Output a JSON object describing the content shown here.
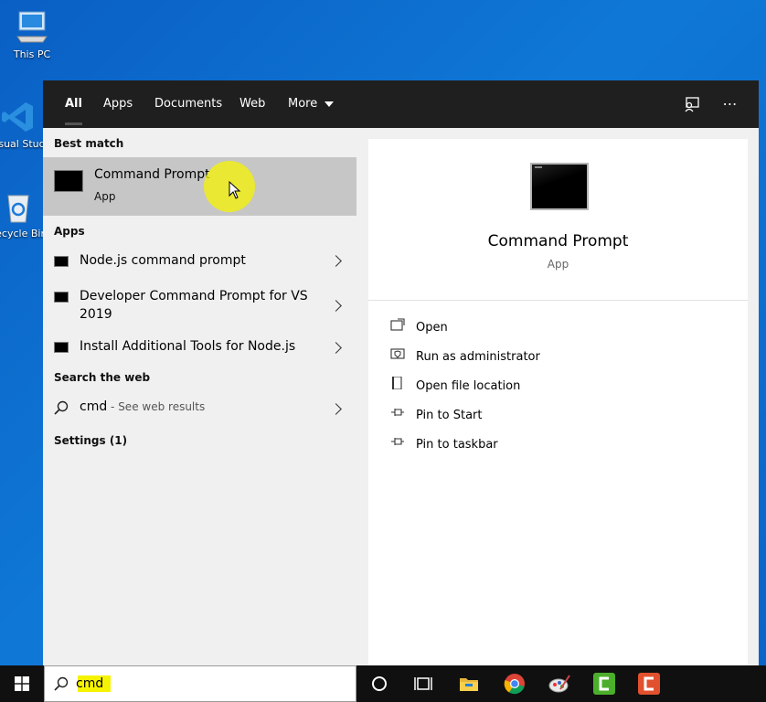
{
  "desktop": {
    "icons": [
      {
        "label": "This PC"
      },
      {
        "label": "Visual Studio Code"
      },
      {
        "label": "Recycle Bin"
      }
    ]
  },
  "search": {
    "tabs": [
      "All",
      "Apps",
      "Documents",
      "Web",
      "More"
    ],
    "best_match_heading": "Best match",
    "best_match": {
      "title": "Command Prompt",
      "subtitle": "App"
    },
    "apps_heading": "Apps",
    "apps": [
      {
        "label": "Node.js command prompt"
      },
      {
        "label": "Developer Command Prompt for VS 2019"
      },
      {
        "label": "Install Additional Tools for Node.js"
      }
    ],
    "web_heading": "Search the web",
    "web_query": "cmd",
    "web_hint": " - See web results",
    "settings_heading": "Settings (1)"
  },
  "preview": {
    "title": "Command Prompt",
    "subtitle": "App",
    "actions": [
      "Open",
      "Run as administrator",
      "Open file location",
      "Pin to Start",
      "Pin to taskbar"
    ]
  },
  "taskbar": {
    "search_value": "cmd"
  },
  "colors": {
    "accent_highlight": "#f5f300",
    "best_match_bg": "#c6c6c6",
    "topbar_bg": "#1f1f1f"
  }
}
